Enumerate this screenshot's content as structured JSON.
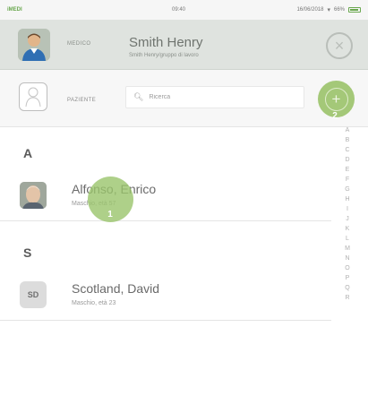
{
  "status_bar": {
    "carrier": "iMEDI",
    "time": "09:40",
    "date": "16/06/2018",
    "battery": "66%"
  },
  "doctor": {
    "role": "MEDICO",
    "name": "Smith Henry",
    "subtitle": "Smith Henry/gruppo di lavoro"
  },
  "patient_row": {
    "label": "PAZIENTE",
    "search_placeholder": "Ricerca"
  },
  "sections": [
    {
      "letter": "A",
      "patients": [
        {
          "name": "Alfonso, Enrico",
          "details": "Maschio, età 57",
          "photo": "portrait-photo"
        }
      ]
    },
    {
      "letter": "S",
      "patients": [
        {
          "name": "Scotland, David",
          "details": "Maschio, età 23",
          "initials": "SD"
        }
      ]
    }
  ],
  "alphabet_index": [
    "A",
    "B",
    "C",
    "D",
    "E",
    "F",
    "G",
    "H",
    "I",
    "J",
    "K",
    "L",
    "M",
    "N",
    "O",
    "P",
    "Q",
    "R"
  ],
  "callouts": {
    "tap_target": "1",
    "add_button": "2"
  },
  "icons": {
    "doctor": "doctor-avatar-icon",
    "patient": "person-silhouette-icon",
    "search": "search-icon",
    "close": "close-icon",
    "add": "plus-icon"
  },
  "colors": {
    "accent_green": "#a4c878",
    "header_bg": "#dfe3df",
    "patient_row_bg": "#f7f7f7"
  }
}
